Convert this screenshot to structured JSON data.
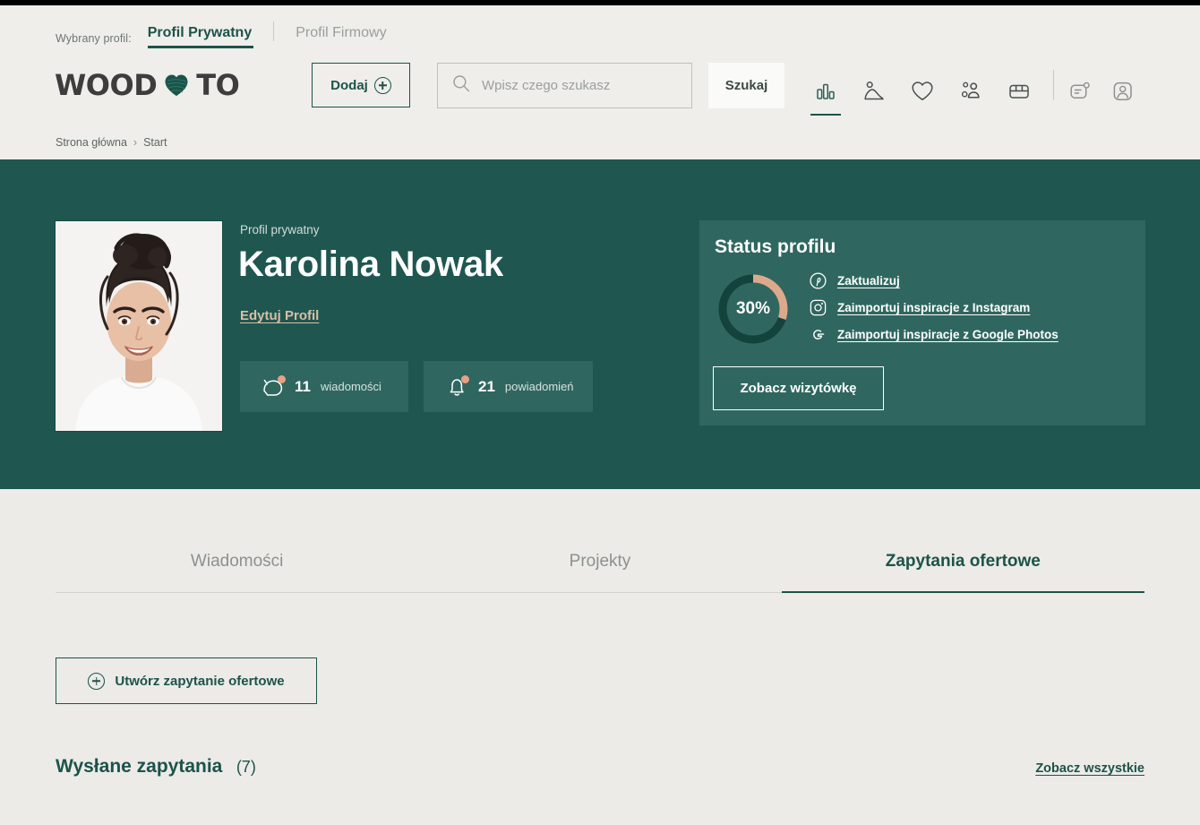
{
  "top_bar": {
    "strip_color": "#000000"
  },
  "profile_switch": {
    "label": "Wybrany profil:",
    "tabs": [
      {
        "label": "Profil Prywatny",
        "active": true
      },
      {
        "label": "Profil Firmowy",
        "active": false
      }
    ]
  },
  "brand": {
    "text_left": "WOOD",
    "text_right": "TO",
    "heart_icon": "heart-icon"
  },
  "toolbar": {
    "add_label": "Dodaj",
    "add_icon": "plus-circle-icon",
    "search_placeholder": "Wpisz czego szukasz",
    "search_value": "",
    "search_icon": "search-icon",
    "search_button_label": "Szukaj"
  },
  "nav_icons": [
    {
      "name": "chart-icon",
      "active": true
    },
    {
      "name": "image-icon",
      "active": false
    },
    {
      "name": "heart-outline-icon",
      "active": false
    },
    {
      "name": "people-icon",
      "active": false
    },
    {
      "name": "store-icon",
      "active": false
    }
  ],
  "nav_icons_right": [
    {
      "name": "messages-icon"
    },
    {
      "name": "account-icon"
    }
  ],
  "breadcrumb": {
    "items": [
      "Strona główna",
      "Start"
    ],
    "separator": "›"
  },
  "hero": {
    "avatar_alt": "portrait-photo",
    "profile_kind": "Profil prywatny",
    "name": "Karolina Nowak",
    "edit_link": "Edytuj Profil",
    "stats": [
      {
        "icon": "chat-icon",
        "value": "11",
        "label": "wiadomości"
      },
      {
        "icon": "bell-icon",
        "value": "21",
        "label": "powiadomień"
      }
    ]
  },
  "status_panel": {
    "title": "Status profilu",
    "percent_label": "30%",
    "percent_value": 30,
    "ring_filled_color": "#DCA98C",
    "ring_track_color": "#14423C",
    "links": [
      {
        "icon": "pinterest-icon",
        "label": "Zaktualizuj"
      },
      {
        "icon": "instagram-icon",
        "label": "Zaimportuj inspiracje z Instagram"
      },
      {
        "icon": "google-icon",
        "label": "Zaimportuj inspiracje z Google Photos"
      }
    ],
    "button_label": "Zobacz wizytówkę"
  },
  "tabs": [
    {
      "label": "Wiadomości",
      "active": false
    },
    {
      "label": "Projekty",
      "active": false
    },
    {
      "label": "Zapytania ofertowe",
      "active": true
    }
  ],
  "content": {
    "create_button_label": "Utwórz zapytanie ofertowe",
    "create_button_icon": "plus-circle-icon",
    "sent_title": "Wysłane zapytania",
    "sent_count": "(7)",
    "see_all_label": "Zobacz wszystkie"
  },
  "colors": {
    "brand_green": "#1C5349",
    "hero_green": "#1F5650",
    "panel_green": "#2F6760",
    "accent_tan": "#DCA98C",
    "page_bg": "#ECEBE8",
    "header_bg": "#EFEEEB"
  }
}
